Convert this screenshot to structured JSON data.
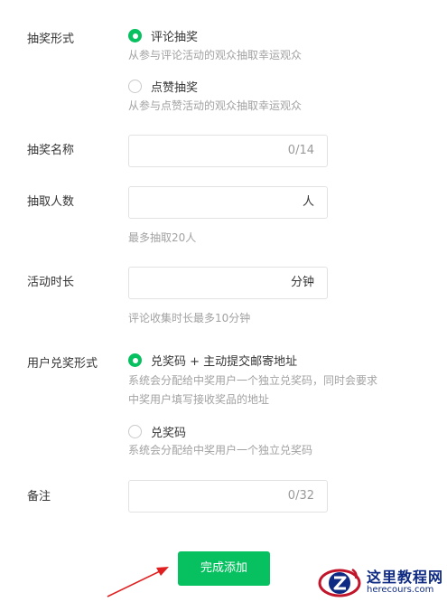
{
  "lottery_mode": {
    "label": "抽奖形式",
    "options": [
      {
        "label": "评论抽奖",
        "desc": "从参与评论活动的观众抽取幸运观众",
        "selected": true
      },
      {
        "label": "点赞抽奖",
        "desc": "从参与点赞活动的观众抽取幸运观众",
        "selected": false
      }
    ]
  },
  "lottery_name": {
    "label": "抽奖名称",
    "value": "",
    "counter": "0/14"
  },
  "winner_count": {
    "label": "抽取人数",
    "value": "",
    "unit": "人",
    "hint": "最多抽取20人"
  },
  "duration": {
    "label": "活动时长",
    "value": "",
    "unit": "分钟",
    "hint": "评论收集时长最多10分钟"
  },
  "redeem_mode": {
    "label": "用户兑奖形式",
    "options": [
      {
        "label": "兑奖码 + 主动提交邮寄地址",
        "desc_line1": "系统会分配给中奖用户一个独立兑奖码，同时会要求",
        "desc_line2": "中奖用户填写接收奖品的地址",
        "selected": true
      },
      {
        "label": "兑奖码",
        "desc_line1": "系统会分配给中奖用户一个独立兑奖码",
        "selected": false
      }
    ]
  },
  "remark": {
    "label": "备注",
    "value": "",
    "counter": "0/32"
  },
  "submit_label": "完成添加",
  "watermark": {
    "title": "这里教程网",
    "url": "herecours.com"
  },
  "colors": {
    "accent": "#07c160",
    "arrow": "#e02020",
    "watermark": "#0e2a82"
  }
}
